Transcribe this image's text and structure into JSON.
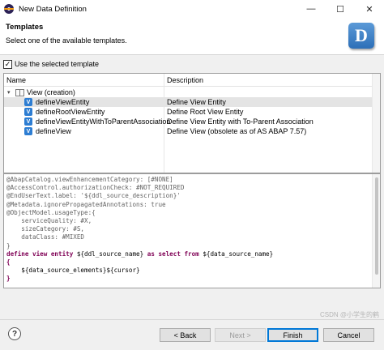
{
  "window": {
    "title": "New Data Definition",
    "controls": {
      "minimize": "—",
      "maximize": "☐",
      "close": "✕"
    }
  },
  "header": {
    "title": "Templates",
    "subtitle": "Select one of the available templates.",
    "logo_letter": "D"
  },
  "use_template": {
    "label": "Use the selected template",
    "checked": true,
    "mark": "✓"
  },
  "table": {
    "columns": [
      "Name",
      "Description"
    ],
    "rows": [
      {
        "name": "View (creation)",
        "description": "",
        "level": 0,
        "icon": "book-icon",
        "expanded": true,
        "selected": false
      },
      {
        "name": "defineViewEntity",
        "description": "Define View Entity",
        "level": 1,
        "icon": "template-icon",
        "selected": true
      },
      {
        "name": "defineRootViewEntity",
        "description": "Define Root View Entity",
        "level": 1,
        "icon": "template-icon",
        "selected": false
      },
      {
        "name": "defineViewEntityWithToParentAssociation",
        "description": "Define View Entity with To-Parent Association",
        "level": 1,
        "icon": "template-icon",
        "selected": false
      },
      {
        "name": "defineView",
        "description": "Define View (obsolete as of AS ABAP 7.57)",
        "level": 1,
        "icon": "template-icon",
        "selected": false
      }
    ]
  },
  "editor": {
    "lines": [
      [
        {
          "t": "@AbapCatalog.viewEnhancementCategory: [#NONE]",
          "c": "anno"
        }
      ],
      [
        {
          "t": "@AccessControl.authorizationCheck: #NOT_REQUIRED",
          "c": "anno"
        }
      ],
      [
        {
          "t": "@EndUserText.label: ",
          "c": "anno"
        },
        {
          "t": "'${ddl_source_description}'",
          "c": "anno"
        }
      ],
      [
        {
          "t": "@Metadata.ignorePropagatedAnnotations: true",
          "c": "anno"
        }
      ],
      [
        {
          "t": "@ObjectModel.usageType:{",
          "c": "anno"
        }
      ],
      [
        {
          "t": "    serviceQuality: #X,",
          "c": "anno"
        }
      ],
      [
        {
          "t": "    sizeCategory: #S,",
          "c": "anno"
        }
      ],
      [
        {
          "t": "    dataClass: #MIXED",
          "c": "anno"
        }
      ],
      [
        {
          "t": "}",
          "c": "anno"
        }
      ],
      [
        {
          "t": "define view entity ",
          "c": "kw"
        },
        {
          "t": "${ddl_source_name}",
          "c": "dflt"
        },
        {
          "t": " as select from ",
          "c": "kw"
        },
        {
          "t": "${data_source_name}",
          "c": "dflt"
        }
      ],
      [
        {
          "t": "{",
          "c": "kw"
        }
      ],
      [
        {
          "t": "    ${data_source_elements}${cursor}",
          "c": "dflt"
        }
      ],
      [
        {
          "t": "}",
          "c": "kw"
        }
      ]
    ],
    "colors": {
      "anno": "#646464",
      "kw": "#7f0055",
      "dflt": "#000000"
    }
  },
  "buttons": {
    "help": "?",
    "back": "< Back",
    "next": "Next >",
    "finish": "Finish",
    "cancel": "Cancel"
  },
  "watermark": "CSDN @小学生的鹤"
}
